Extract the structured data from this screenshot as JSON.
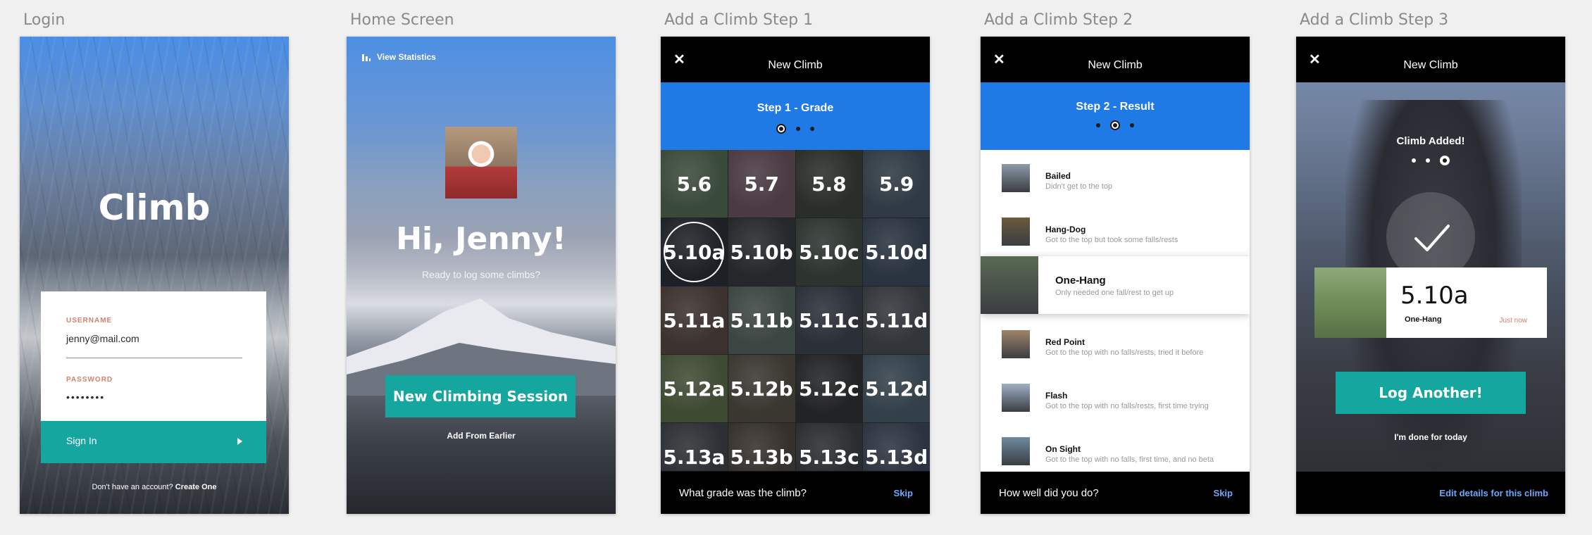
{
  "frames": {
    "login": "Login",
    "home": "Home Screen",
    "step1": "Add a Climb Step 1",
    "step2": "Add a Climb Step 2",
    "step3": "Add a Climb Step 3"
  },
  "login": {
    "app_title": "Climb",
    "username_label": "USERNAME",
    "username_value": "jenny@mail.com",
    "password_label": "PASSWORD",
    "password_value": "••••••••",
    "sign_in": "Sign In",
    "footer_text": "Don't have an account?",
    "footer_link": "Create One"
  },
  "home": {
    "stats_link": "View Statistics",
    "greeting": "Hi, Jenny!",
    "subtitle": "Ready to log some climbs?",
    "new_session": "New Climbing Session",
    "add_earlier": "Add From Earlier"
  },
  "step1": {
    "header": "New Climb",
    "step_title": "Step 1 - Grade",
    "active_step": 1,
    "grades": [
      "5.6",
      "5.7",
      "5.8",
      "5.9",
      "5.10a",
      "5.10b",
      "5.10c",
      "5.10d",
      "5.11a",
      "5.11b",
      "5.11c",
      "5.11d",
      "5.12a",
      "5.12b",
      "5.12c",
      "5.12d",
      "5.13a",
      "5.13b",
      "5.13c",
      "5.13d"
    ],
    "selected_grade": "5.10a",
    "question": "What grade was the climb?",
    "skip": "Skip"
  },
  "step2": {
    "header": "New Climb",
    "step_title": "Step 2 - Result",
    "active_step": 2,
    "results": [
      {
        "name": "Bailed",
        "desc": "Didn't get to the top"
      },
      {
        "name": "Hang-Dog",
        "desc": "Got to the top but took some falls/rests"
      },
      {
        "name": "One-Hang",
        "desc": "Only needed one fall/rest to get up"
      },
      {
        "name": "Red Point",
        "desc": "Got to the top with no falls/rests, tried it before"
      },
      {
        "name": "Flash",
        "desc": "Got to the top with no falls/rests, first time trying"
      },
      {
        "name": "On Sight",
        "desc": "Got to the top with no falls, first time, and no beta"
      }
    ],
    "selected_result": "One-Hang",
    "question": "How well did you do?",
    "skip": "Skip"
  },
  "step3": {
    "header": "New Climb",
    "step_title": "Climb Added!",
    "active_step": 3,
    "card_grade": "5.10a",
    "card_result": "One-Hang",
    "card_time": "Just now",
    "log_another": "Log Another!",
    "done": "I'm done for today",
    "edit": "Edit details for this climb"
  },
  "colors": {
    "teal": "#15a69f",
    "blue": "#1f7ae6",
    "label_salmon": "#d6806d",
    "link_blue": "#6da8ff"
  }
}
